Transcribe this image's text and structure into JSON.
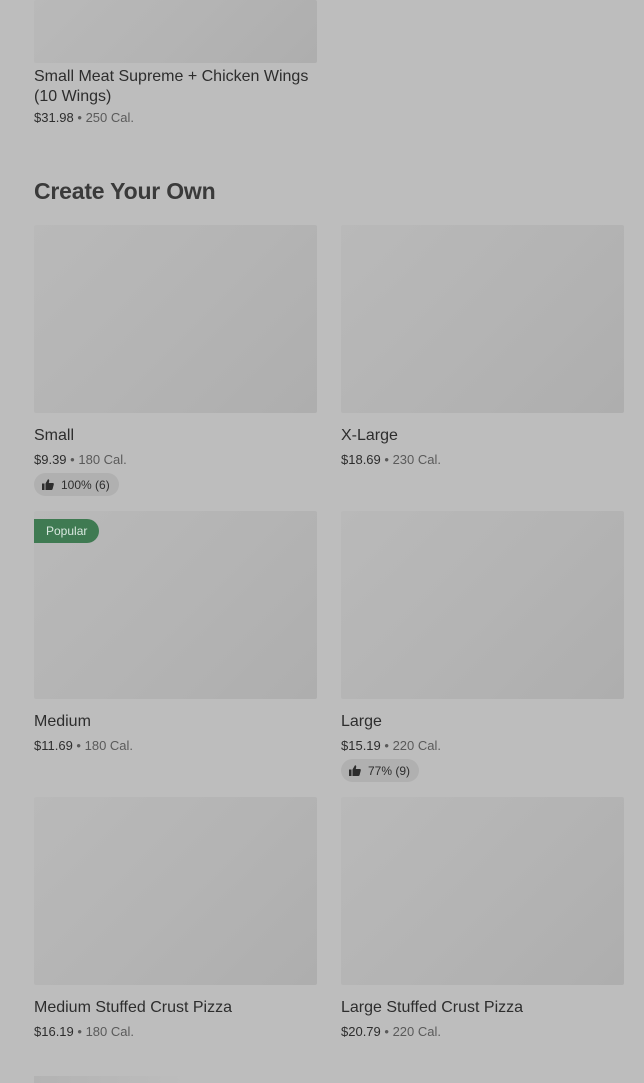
{
  "top_item": {
    "name": "Small Meat Supreme + Chicken Wings (10 Wings)",
    "price": "$31.98",
    "separator": "•",
    "calories": "250 Cal."
  },
  "section": {
    "title": "Create Your Own"
  },
  "items": [
    {
      "name": "Small",
      "price": "$9.39",
      "separator": "•",
      "calories": "180 Cal.",
      "rating": "100% (6)"
    },
    {
      "name": "X-Large",
      "price": "$18.69",
      "separator": "•",
      "calories": "230 Cal."
    },
    {
      "name": "Medium",
      "price": "$11.69",
      "separator": "•",
      "calories": "180 Cal.",
      "badge": "Popular"
    },
    {
      "name": "Large",
      "price": "$15.19",
      "separator": "•",
      "calories": "220 Cal.",
      "rating": "77% (9)"
    },
    {
      "name": "Medium Stuffed Crust Pizza",
      "price": "$16.19",
      "separator": "•",
      "calories": "180 Cal."
    },
    {
      "name": "Large Stuffed Crust Pizza",
      "price": "$20.79",
      "separator": "•",
      "calories": "220 Cal."
    }
  ],
  "icons": {
    "rating_icon": "thumbs-up-icon"
  },
  "colors": {
    "overlay_background": "#bdbdbd",
    "badge_background": "#3f7a52",
    "text": "#2d2d2d"
  }
}
